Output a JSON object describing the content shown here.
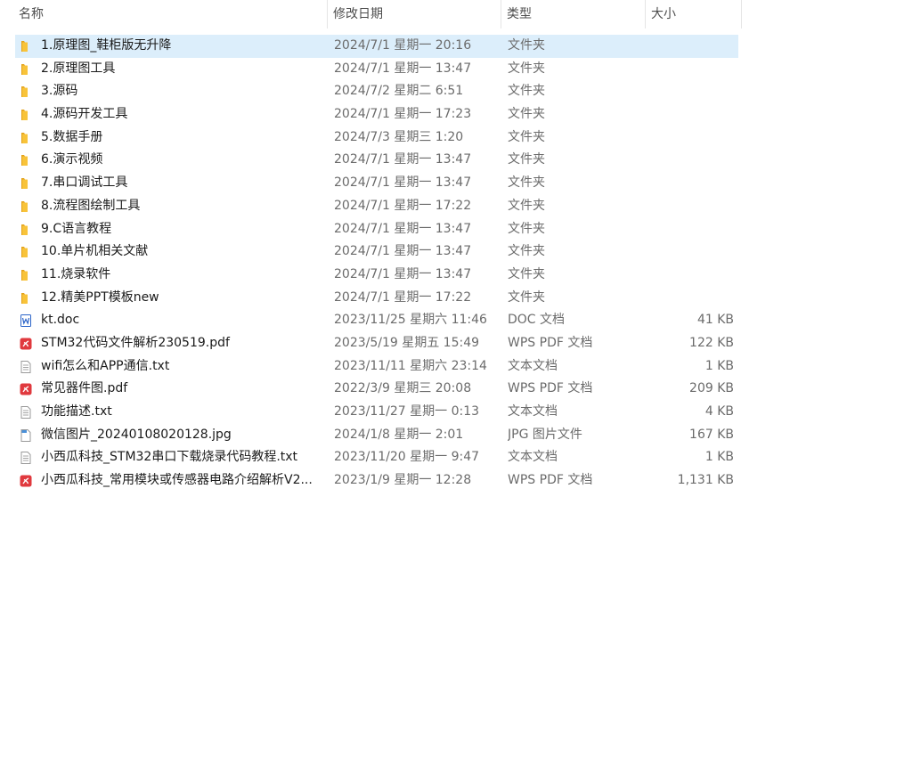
{
  "columns": {
    "name": "名称",
    "date": "修改日期",
    "type": "类型",
    "size": "大小"
  },
  "sort_indicator": "^",
  "files": [
    {
      "name": "1.原理图_鞋柜版无升降",
      "date": "2024/7/1 星期一 20:16",
      "type": "文件夹",
      "size": "",
      "icon": "folder-icon",
      "selected": true
    },
    {
      "name": "2.原理图工具",
      "date": "2024/7/1 星期一 13:47",
      "type": "文件夹",
      "size": "",
      "icon": "folder-icon"
    },
    {
      "name": "3.源码",
      "date": "2024/7/2 星期二 6:51",
      "type": "文件夹",
      "size": "",
      "icon": "folder-icon"
    },
    {
      "name": "4.源码开发工具",
      "date": "2024/7/1 星期一 17:23",
      "type": "文件夹",
      "size": "",
      "icon": "folder-icon"
    },
    {
      "name": "5.数据手册",
      "date": "2024/7/3 星期三 1:20",
      "type": "文件夹",
      "size": "",
      "icon": "folder-icon"
    },
    {
      "name": "6.演示视频",
      "date": "2024/7/1 星期一 13:47",
      "type": "文件夹",
      "size": "",
      "icon": "folder-icon"
    },
    {
      "name": "7.串口调试工具",
      "date": "2024/7/1 星期一 13:47",
      "type": "文件夹",
      "size": "",
      "icon": "folder-icon"
    },
    {
      "name": "8.流程图绘制工具",
      "date": "2024/7/1 星期一 17:22",
      "type": "文件夹",
      "size": "",
      "icon": "folder-icon"
    },
    {
      "name": "9.C语言教程",
      "date": "2024/7/1 星期一 13:47",
      "type": "文件夹",
      "size": "",
      "icon": "folder-icon"
    },
    {
      "name": "10.单片机相关文献",
      "date": "2024/7/1 星期一 13:47",
      "type": "文件夹",
      "size": "",
      "icon": "folder-icon"
    },
    {
      "name": "11.烧录软件",
      "date": "2024/7/1 星期一 13:47",
      "type": "文件夹",
      "size": "",
      "icon": "folder-icon"
    },
    {
      "name": "12.精美PPT模板new",
      "date": "2024/7/1 星期一 17:22",
      "type": "文件夹",
      "size": "",
      "icon": "folder-icon"
    },
    {
      "name": "kt.doc",
      "date": "2023/11/25 星期六 11:46",
      "type": "DOC 文档",
      "size": "41 KB",
      "icon": "word-doc-icon"
    },
    {
      "name": "STM32代码文件解析230519.pdf",
      "date": "2023/5/19 星期五 15:49",
      "type": "WPS PDF 文档",
      "size": "122 KB",
      "icon": "pdf-icon"
    },
    {
      "name": "wifi怎么和APP通信.txt",
      "date": "2023/11/11 星期六 23:14",
      "type": "文本文档",
      "size": "1 KB",
      "icon": "text-file-icon"
    },
    {
      "name": "常见器件图.pdf",
      "date": "2022/3/9 星期三 20:08",
      "type": "WPS PDF 文档",
      "size": "209 KB",
      "icon": "pdf-icon"
    },
    {
      "name": "功能描述.txt",
      "date": "2023/11/27 星期一 0:13",
      "type": "文本文档",
      "size": "4 KB",
      "icon": "text-file-icon"
    },
    {
      "name": "微信图片_20240108020128.jpg",
      "date": "2024/1/8 星期一 2:01",
      "type": "JPG 图片文件",
      "size": "167 KB",
      "icon": "image-file-icon"
    },
    {
      "name": "小西瓜科技_STM32串口下载烧录代码教程.txt",
      "date": "2023/11/20 星期一 9:47",
      "type": "文本文档",
      "size": "1 KB",
      "icon": "text-file-icon"
    },
    {
      "name": "小西瓜科技_常用模块或传感器电路介绍解析V2...",
      "date": "2023/1/9 星期一 12:28",
      "type": "WPS PDF 文档",
      "size": "1,131 KB",
      "icon": "pdf-icon"
    }
  ],
  "colors": {
    "selection": "#dceefb",
    "folder": "#f8c33a",
    "folder_dark": "#e3a21a",
    "pdf": "#e0393e",
    "word": "#2b64c8"
  }
}
